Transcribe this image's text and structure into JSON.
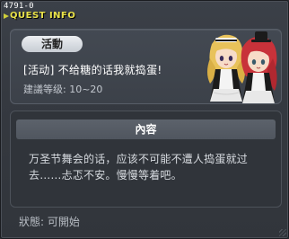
{
  "window": {
    "quest_id": "4791-0",
    "title": "QUEST INFO"
  },
  "quest": {
    "category_badge": "活動",
    "name": "[活动] 不给糖的话我就捣蛋!",
    "recommended_level": "建議等级: 10~20"
  },
  "description": {
    "header": "內容",
    "text": "万圣节舞会的话，应该不可能不遭人捣蛋就过去……忐忑不安。慢慢等着吧。"
  },
  "status": {
    "text": "狀態: 可開始"
  },
  "colors": {
    "title": "#e9e24a",
    "background": "#353940",
    "card": "#404650",
    "header": "#565c65"
  }
}
